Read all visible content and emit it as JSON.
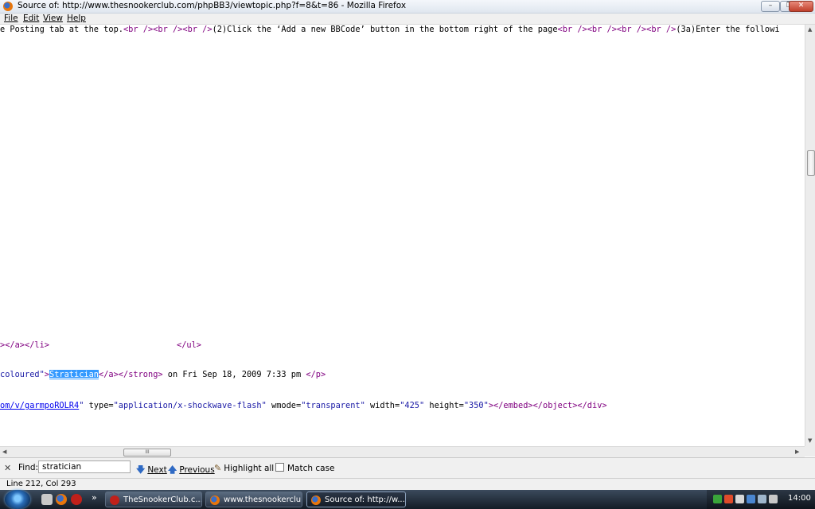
{
  "window": {
    "title": "Source of: http://www.thesnookerclub.com/phpBB3/viewtopic.php?f=8&t=86 - Mozilla Firefox",
    "minimize": "–",
    "maximize": "❐",
    "close": "✕"
  },
  "menu": [
    "File",
    "Edit",
    "View",
    "Help"
  ],
  "source_lines": {
    "line1": {
      "p1": "e Posting tab at the top.",
      "tags1": "<br /><br /><br />",
      "p2": "(2)Click the ‘Add a new BBCode’ button in the bottom right of the page",
      "tags2": "<br /><br /><br /><br />",
      "p3": "(3a)Enter the followi"
    },
    "line2": {
      "t1": "></a></li>",
      "t2": "</ul>"
    },
    "line3": {
      "v1": "coloured\"",
      "t1": ">",
      "sel": "Stratician",
      "t2": "</a></strong>",
      "text": " on Fri Sep 18, 2009 7:33 pm ",
      "t3": "</p>"
    },
    "line4": {
      "link": "om/v/garmpoROLR4",
      "q": "\" ",
      "a1": "type=",
      "v1": "\"application/x-shockwave-flash\"",
      "a2": " wmode=",
      "v2": "\"transparent\"",
      "a3": " width=",
      "v3": "\"425\"",
      "a4": " height=",
      "v4": "\"350\"",
      "t1": "></embed></object></div>"
    }
  },
  "hscroll_grip": "III",
  "findbar": {
    "close": "✕",
    "label": "Find:",
    "value": "stratician",
    "next": "Next",
    "previous": "Previous",
    "highlight_all": "Highlight all",
    "match_case": "Match case"
  },
  "status": "Line 212, Col 293",
  "taskbar": {
    "tasks": [
      "TheSnookerClub.c...",
      "www.thesnookerclu...",
      "Source of: http://w..."
    ],
    "clock": "14:00",
    "quicklaunch_more": "»"
  },
  "colors": {
    "tag": "#800080",
    "value": "#1a1aa6",
    "link": "#0000ee",
    "selection": "#3399ff"
  }
}
